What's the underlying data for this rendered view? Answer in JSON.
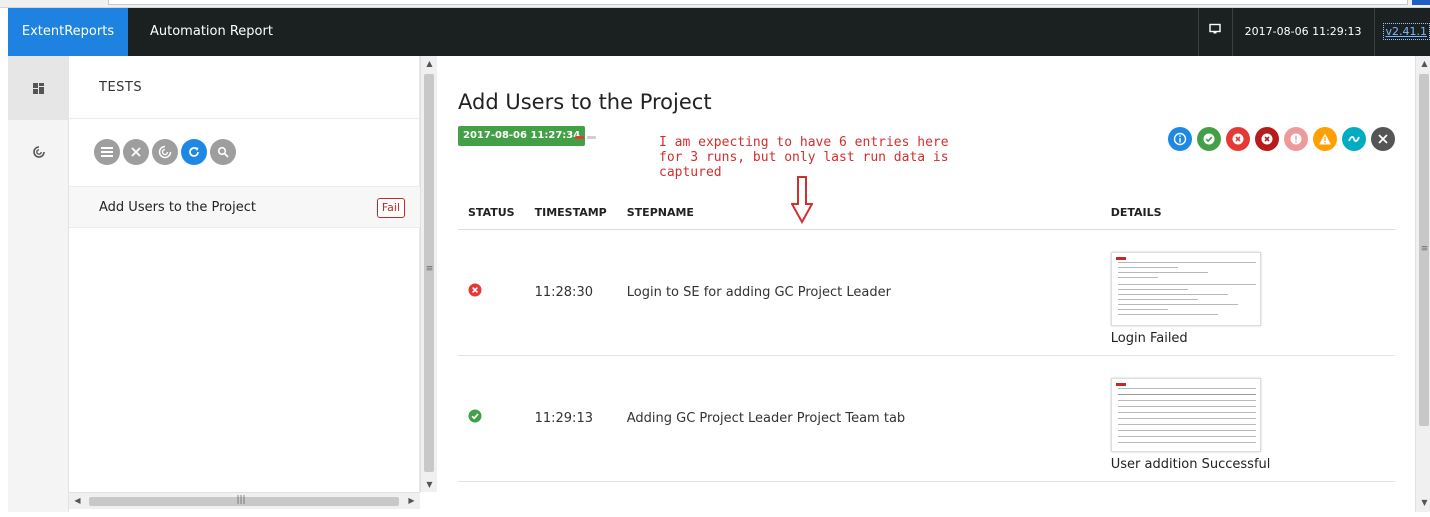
{
  "navbar": {
    "brand": "ExtentReports",
    "report_name": "Automation Report",
    "datetime": "2017-08-06 11:29:13",
    "version": "v2.41.1"
  },
  "sidenav": {
    "items": [
      {
        "icon": "dashboard-grid-icon",
        "active": true
      },
      {
        "icon": "radar-icon",
        "active": false
      }
    ]
  },
  "tests_panel": {
    "title": "TESTS",
    "filters": [
      {
        "icon": "list-icon",
        "color": "#9e9e9e"
      },
      {
        "icon": "close-icon",
        "color": "#9e9e9e"
      },
      {
        "icon": "radar-icon",
        "color": "#9e9e9e"
      },
      {
        "icon": "refresh-icon",
        "color": "#1e88e5"
      },
      {
        "icon": "search-icon",
        "color": "#9e9e9e"
      }
    ],
    "items": [
      {
        "name": "Add Users to the Project",
        "status": "Fail"
      }
    ]
  },
  "test": {
    "title": "Add Users to the Project",
    "start_time": "2017-08-06 11:27:34",
    "annotation": "I am expecting to have 6 entries here\nfor 3 runs, but only last run data is\ncaptured",
    "status_filters": [
      {
        "icon": "info-icon",
        "color": "#1e88e5"
      },
      {
        "icon": "pass-icon",
        "color": "#43a047"
      },
      {
        "icon": "fail-icon",
        "color": "#e53935"
      },
      {
        "icon": "fatal-icon",
        "color": "#b71c1c"
      },
      {
        "icon": "error-icon",
        "color": "#ef9a9a"
      },
      {
        "icon": "warning-icon",
        "color": "#ffa000"
      },
      {
        "icon": "skip-icon",
        "color": "#00acc1"
      },
      {
        "icon": "clear-icon",
        "color": "#555555"
      }
    ],
    "columns": [
      "STATUS",
      "TIMESTAMP",
      "STEPNAME",
      "DETAILS"
    ],
    "steps": [
      {
        "status": "fail",
        "timestamp": "11:28:30",
        "stepname": "Login to SE for adding GC Project Leader",
        "details": "Login Failed"
      },
      {
        "status": "pass",
        "timestamp": "11:29:13",
        "stepname": "Adding GC Project Leader Project Team tab",
        "details": "User addition Successful"
      }
    ]
  },
  "colors": {
    "navbar": "#1b2121",
    "brand": "#1e82e0",
    "pass": "#43a047",
    "fail": "#e53935",
    "annotation": "#d32f2f"
  }
}
